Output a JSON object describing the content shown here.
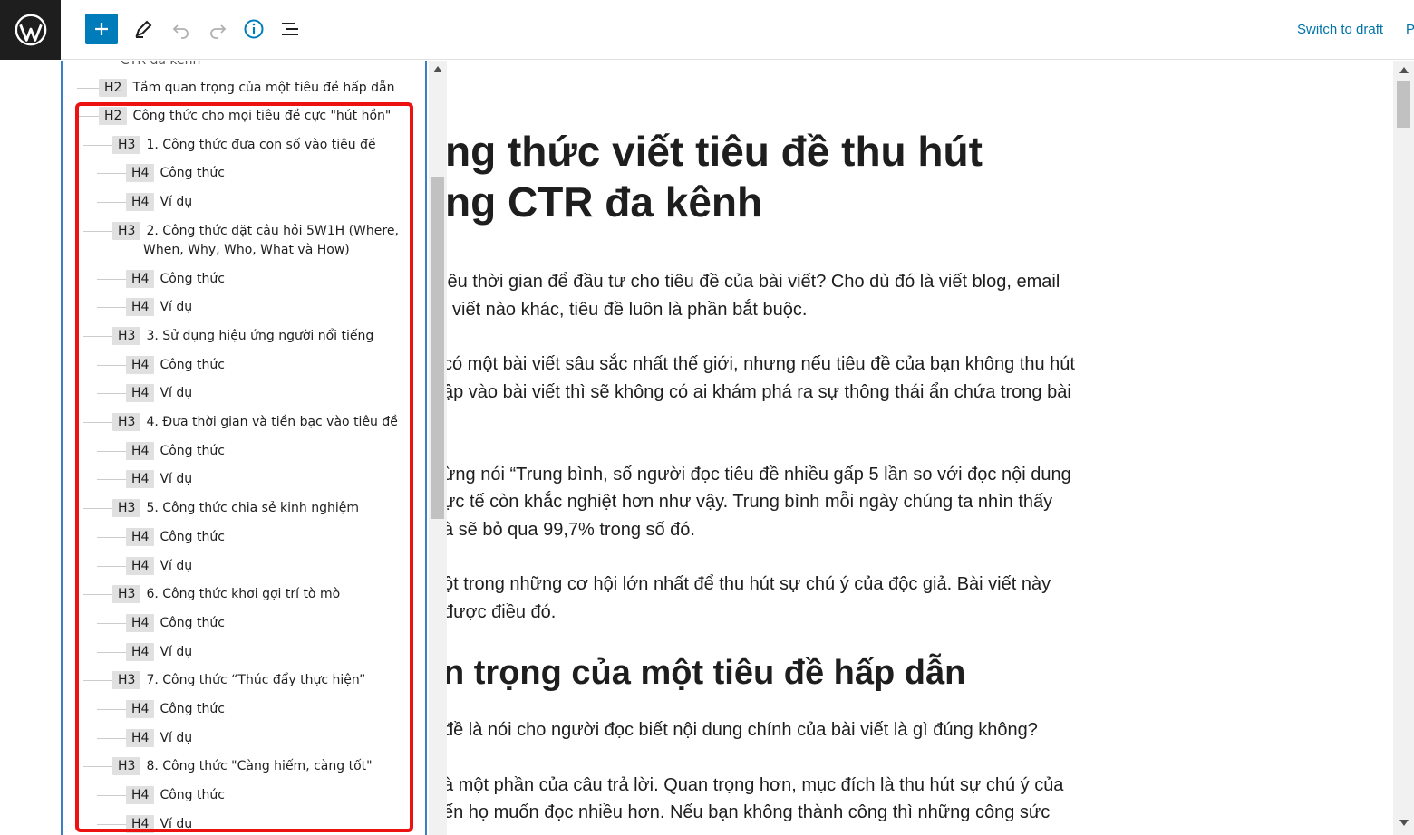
{
  "toolbar": {
    "switch_to_draft": "Switch to draft",
    "publish_partial": "P"
  },
  "outline": {
    "cut_top_text": "CTR đa kênh",
    "items": [
      {
        "level": "H2",
        "text": "Tầm quan trọng của một tiêu đề hấp dẫn"
      },
      {
        "level": "H2",
        "text": "Công thức cho mọi tiêu đề cực \"hút hồn\""
      },
      {
        "level": "H3",
        "text": "1. Công thức đưa con số vào tiêu đề"
      },
      {
        "level": "H4",
        "text": "Công thức"
      },
      {
        "level": "H4",
        "text": "Ví dụ"
      },
      {
        "level": "H3",
        "text": "2. Công thức đặt câu hỏi 5W1H (Where,",
        "text2": "When, Why, Who, What và How)"
      },
      {
        "level": "H4",
        "text": "Công thức"
      },
      {
        "level": "H4",
        "text": "Ví dụ"
      },
      {
        "level": "H3",
        "text": "3. Sử dụng hiệu ứng người nổi tiếng"
      },
      {
        "level": "H4",
        "text": "Công thức"
      },
      {
        "level": "H4",
        "text": "Ví dụ"
      },
      {
        "level": "H3",
        "text": "4. Đưa thời gian và tiền bạc vào tiêu đề"
      },
      {
        "level": "H4",
        "text": "Công thức"
      },
      {
        "level": "H4",
        "text": "Ví dụ"
      },
      {
        "level": "H3",
        "text": "5. Công thức chia sẻ kinh nghiệm"
      },
      {
        "level": "H4",
        "text": "Công thức"
      },
      {
        "level": "H4",
        "text": "Ví dụ"
      },
      {
        "level": "H3",
        "text": "6. Công thức khơi gợi trí tò mò"
      },
      {
        "level": "H4",
        "text": "Công thức"
      },
      {
        "level": "H4",
        "text": "Ví dụ"
      },
      {
        "level": "H3",
        "text": "7. Công thức “Thúc đẩy thực hiện”"
      },
      {
        "level": "H4",
        "text": "Công thức"
      },
      {
        "level": "H4",
        "text": "Ví dụ"
      },
      {
        "level": "H3",
        "text": "8. Công thức \"Càng hiếm, càng tốt\""
      },
      {
        "level": "H4",
        "text": "Công thức"
      },
      {
        "level": "H4",
        "text": "Ví dụ"
      }
    ]
  },
  "content": {
    "title_line1": "ng thức viết tiêu đề thu hút",
    "title_line2": "ng CTR đa kênh",
    "p1_l1": "iêu thời gian để đầu tư cho tiêu đề của bài viết? Cho dù đó là viết blog, email",
    "p1_l2": "i viết nào khác, tiêu đề luôn là phần bắt buộc.",
    "p2_l1": "có một bài viết sâu sắc nhất thế giới, nhưng nếu tiêu đề của bạn không thu hút",
    "p2_l2": "ập vào bài viết thì sẽ không có ai khám phá ra sự thông thái ẩn chứa trong bài",
    "p3_l1": "ừng nói “Trung bình, số người đọc tiêu đề nhiều gấp 5 lần so với đọc nội dung",
    "p3_l2": "ực tế còn khắc nghiệt hơn như vậy. Trung bình mỗi ngày chúng ta nhìn thấy",
    "p3_l3": "à sẽ bỏ qua 99,7% trong số đó.",
    "p4_l1": "ột trong những cơ hội lớn nhất để thu hút sự chú ý của độc giả. Bài viết này",
    "p4_l2": "được điều đó.",
    "h2": "n trọng của một tiêu đề hấp dẫn",
    "p5_l1": "đề là nói cho người đọc biết nội dung chính của bài viết là gì đúng không?",
    "p6_l1": "à một phần của câu trả lời. Quan trọng hơn, mục đích là thu hút sự chú ý của",
    "p6_l2": "ến họ muốn đọc nhiều hơn. Nếu bạn không thành công thì những công sức"
  },
  "colors": {
    "accent": "#007cba",
    "highlight": "#ee1111",
    "sidebar_dark": "#1e1e1e"
  }
}
